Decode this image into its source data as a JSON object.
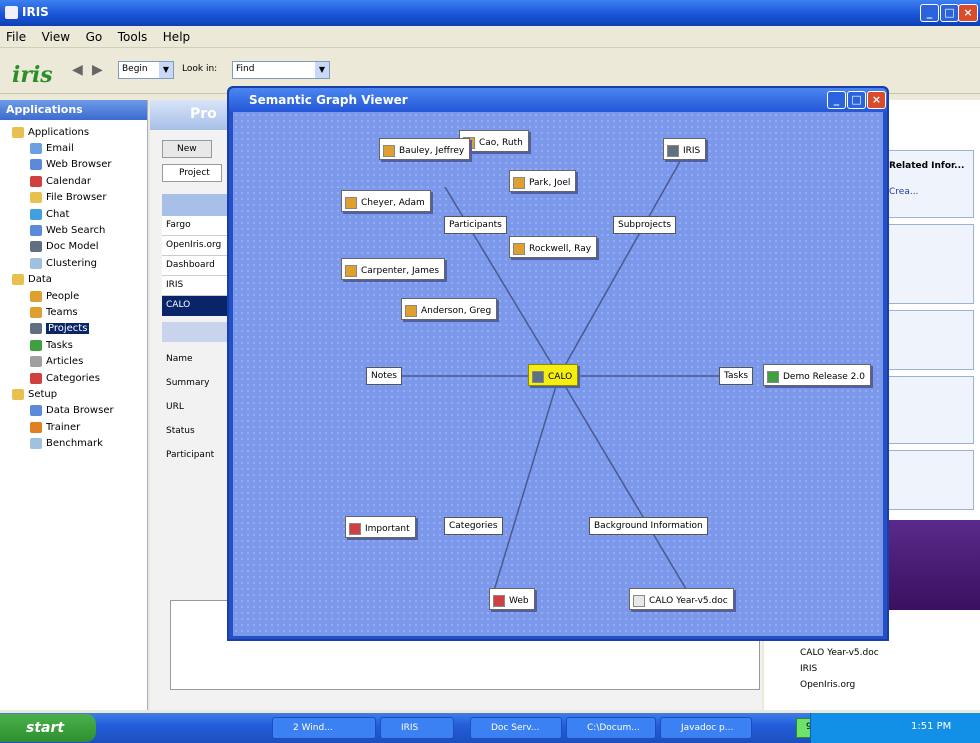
{
  "window": {
    "title": "IRIS"
  },
  "menu": [
    "File",
    "View",
    "Go",
    "Tools",
    "Help"
  ],
  "toolbar": {
    "logo": "iris",
    "back": "◀",
    "forward": "▶",
    "lookin_label": "Look in:",
    "combo1": "Begin",
    "combo2": "Find"
  },
  "left_panel": {
    "header": "Applications",
    "items": [
      {
        "label": "Applications",
        "color": "#e8c050"
      },
      {
        "label": "Email",
        "color": "#6aa0e0"
      },
      {
        "label": "Web Browser",
        "color": "#5a8ad8"
      },
      {
        "label": "Calendar",
        "color": "#d04040"
      },
      {
        "label": "File Browser",
        "color": "#e8c050"
      },
      {
        "label": "Chat",
        "color": "#40a0e0"
      },
      {
        "label": "Web Search",
        "color": "#5a8ad8"
      },
      {
        "label": "Doc Model",
        "color": "#607080"
      },
      {
        "label": "Clustering",
        "color": "#a0c0e0"
      },
      {
        "label": "Data",
        "color": "#e8c050"
      },
      {
        "label": "People",
        "color": "#e0a030"
      },
      {
        "label": "Teams",
        "color": "#e0a030"
      },
      {
        "label": "Projects",
        "color": "#607080",
        "selected": true
      },
      {
        "label": "Tasks",
        "color": "#40a040"
      },
      {
        "label": "Articles",
        "color": "#a0a0a0"
      },
      {
        "label": "Categories",
        "color": "#d04040"
      },
      {
        "label": "Setup",
        "color": "#e8c050"
      },
      {
        "label": "Data Browser",
        "color": "#5a8ad8"
      },
      {
        "label": "Trainer",
        "color": "#e08020"
      },
      {
        "label": "Benchmark",
        "color": "#a0c0e0"
      }
    ]
  },
  "mid_panel": {
    "title": "Pro",
    "new_btn": "New",
    "tab": "Project",
    "rows": [
      "Fargo",
      "OpenIris.org",
      "Dashboard",
      "IRIS",
      "CALO"
    ],
    "fields": [
      "Name",
      "Summary",
      "URL",
      "Status",
      "Participant"
    ]
  },
  "right_panel": {
    "box1": "Related Infor...",
    "box1_sub": "Crea...",
    "list": [
      "CALO Year-v5.doc",
      "IRIS",
      "OpenIris.org"
    ]
  },
  "graph_viewer": {
    "title": "Semantic Graph Viewer",
    "center": "CALO",
    "nodes": [
      {
        "label": "Cao, Ruth",
        "icon_color": "#e0a030"
      },
      {
        "label": "Bauley, Jeffrey",
        "icon_color": "#e0a030"
      },
      {
        "label": "IRIS",
        "icon_color": "#607080"
      },
      {
        "label": "Park, Joel",
        "icon_color": "#e0a030"
      },
      {
        "label": "Cheyer, Adam",
        "icon_color": "#e0a030"
      },
      {
        "label": "Rockwell, Ray",
        "icon_color": "#e0a030"
      },
      {
        "label": "Carpenter, James",
        "icon_color": "#e0a030"
      },
      {
        "label": "Anderson, Greg",
        "icon_color": "#e0a030"
      },
      {
        "label": "Demo Release 2.0",
        "icon_color": "#40a040"
      },
      {
        "label": "Important",
        "icon_color": "#d04040"
      },
      {
        "label": "Web",
        "icon_color": "#d04040"
      },
      {
        "label": "CALO Year-v5.doc",
        "icon_color": "#a0a0a0"
      }
    ],
    "relations": [
      "Participants",
      "Subprojects",
      "Notes",
      "Tasks",
      "Categories",
      "Background Information"
    ]
  },
  "taskbar": {
    "start": "start",
    "tasks": [
      "2 Wind...",
      "IRIS",
      "Doc Serv...",
      "C:\\Docum...",
      "Javadoc p..."
    ],
    "battery": "98%",
    "clock": "1:51 PM"
  }
}
